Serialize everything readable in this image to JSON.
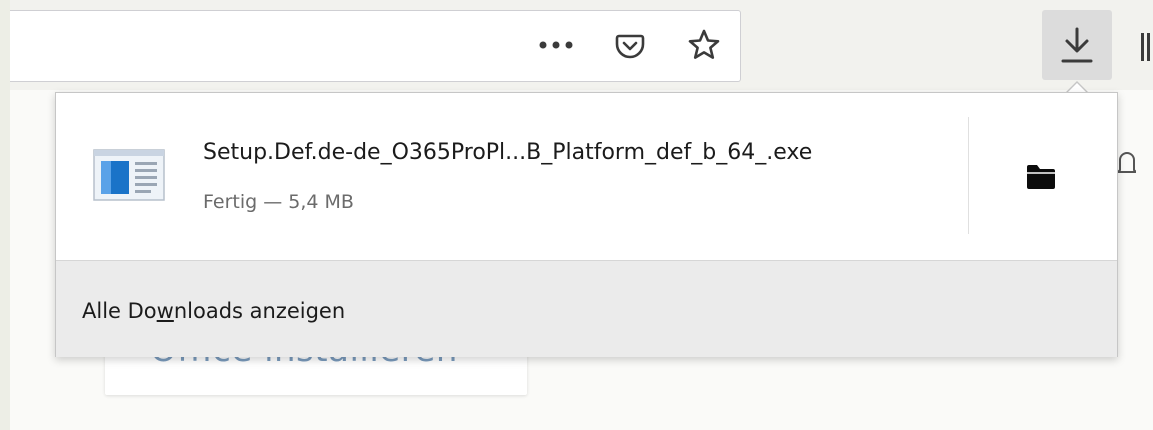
{
  "toolbar": {
    "icons": [
      "more-icon",
      "pocket-icon",
      "star-icon",
      "downloads-icon",
      "library-icon"
    ]
  },
  "page": {
    "card_text": "Office installieren"
  },
  "downloads_panel": {
    "item": {
      "file_name": "Setup.Def.de-de_O365ProPl...B_Platform_def_b_64_.exe",
      "status": "Fertig — 5,4 MB",
      "icon": "exe-file-icon",
      "action_icon": "folder-icon"
    },
    "footer": {
      "label_before": "Alle Do",
      "label_mnemonic": "w",
      "label_after": "nloads anzeigen"
    }
  },
  "colors": {
    "accent_blue": "#1a73c8",
    "toolbar_bg": "#f2f2ee",
    "footer_bg": "#ebebeb"
  }
}
